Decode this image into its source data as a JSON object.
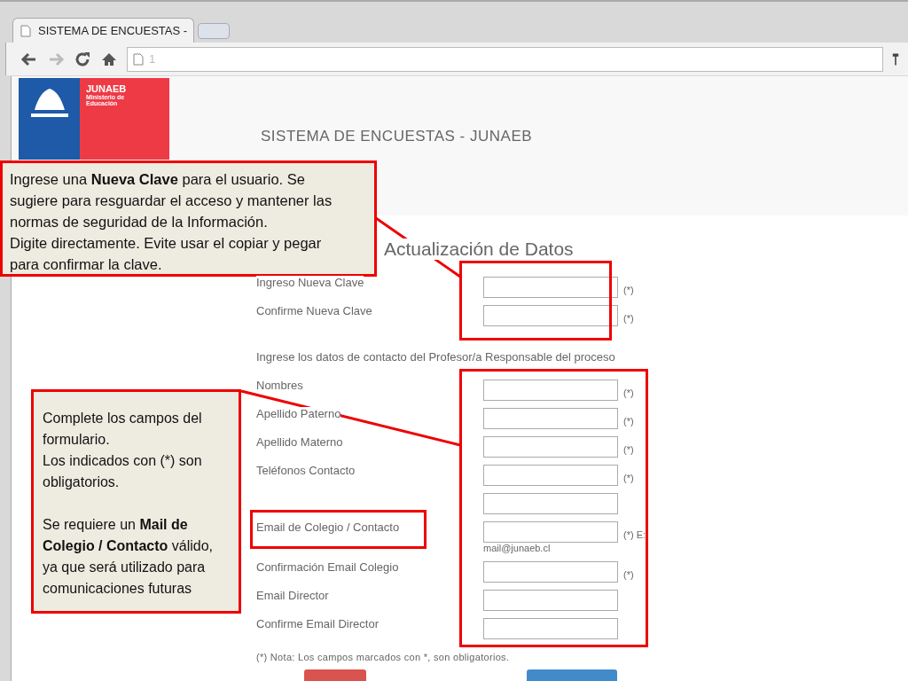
{
  "browser": {
    "tab_title": "SISTEMA DE ENCUESTAS -",
    "url": "1"
  },
  "logo": {
    "name": "JUNAEB",
    "subtitle_1": "Ministerio de",
    "subtitle_2": "Educación"
  },
  "header": {
    "title": "SISTEMA DE ENCUESTAS - JUNAEB"
  },
  "form": {
    "title": "Actualización de Datos",
    "password_rows": [
      {
        "label": "Ingreso Nueva Clave",
        "suffix": "(*)"
      },
      {
        "label": "Confirme Nueva Clave",
        "suffix": "(*)"
      }
    ],
    "contact_intro": "Ingrese los datos de contacto del Profesor/a Responsable del proceso",
    "contact_rows": [
      {
        "label": "Nombres",
        "suffix": "(*)"
      },
      {
        "label": "Apellido Paterno",
        "suffix": "(*)"
      },
      {
        "label": "Apellido Materno",
        "suffix": "(*)"
      },
      {
        "label": "Teléfonos Contacto",
        "suffix": "(*)"
      },
      {},
      {
        "label": "Email de Colegio / Contacto",
        "suffix": "(*) E:",
        "hint": "mail@junaeb.cl"
      },
      {
        "label": "Confirmación Email Colegio",
        "suffix": "(*)"
      },
      {
        "label": "Email Director"
      },
      {
        "label": "Confirme Email Director"
      }
    ],
    "note": "(*) Nota: Los campos marcados con *, son obligatorios.",
    "buttons": [
      {
        "kind": "danger"
      },
      {
        "kind": "primary"
      }
    ]
  },
  "callouts": [
    {
      "paragraphs": [
        "Ingrese una **Nueva Clave** para el usuario. Se sugiere para resguardar el acceso y mantener las normas de seguridad de la Información.",
        "Digite directamente. Evite usar el copiar y pegar para confirmar la clave."
      ]
    },
    {
      "paragraphs": [
        "Complete los campos del formulario.",
        "Los indicados con (*) son obligatorios.",
        "Se requiere un **Mail de Colegio / Contacto** válido, ya que será utilizado para comunicaciones futuras"
      ]
    }
  ]
}
